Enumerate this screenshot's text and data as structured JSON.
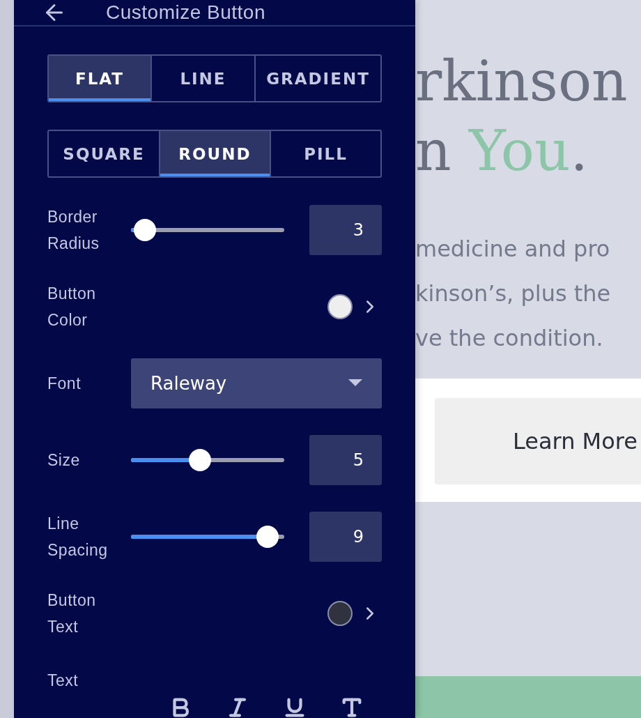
{
  "panel": {
    "title": "Customize Button",
    "styles": [
      {
        "label": "FLAT",
        "selected": true
      },
      {
        "label": "LINE",
        "selected": false
      },
      {
        "label": "GRADIENT",
        "selected": false
      }
    ],
    "shapes": [
      {
        "label": "SQUARE",
        "selected": false
      },
      {
        "label": "ROUND",
        "selected": true
      },
      {
        "label": "PILL",
        "selected": false
      }
    ],
    "rows": [
      {
        "kind": "slider",
        "label": "Border Radius",
        "level": 0.09,
        "value": "3"
      },
      {
        "kind": "color",
        "label": "Button Color",
        "color": "#eeeeee"
      },
      {
        "kind": "dropdown",
        "label": "Font",
        "value": "Raleway"
      },
      {
        "kind": "slider",
        "label": "Size",
        "level": 0.45,
        "value": "5"
      },
      {
        "kind": "slider",
        "label": "Line Spacing",
        "level": 0.89,
        "value": "9"
      },
      {
        "kind": "color",
        "label": "Button Text",
        "color": "#30323f"
      },
      {
        "kind": "format",
        "label": "Text"
      }
    ]
  },
  "preview": {
    "heading": [
      "rkinson",
      [
        {
          "text": "n ",
          "accent": false
        },
        {
          "text": "You",
          "accent": true
        },
        {
          "text": ".",
          "accent": false
        }
      ]
    ],
    "paragraph": [
      "medicine and pro",
      "kinson’s, plus the",
      "ve the condition."
    ],
    "button": "Learn More"
  }
}
